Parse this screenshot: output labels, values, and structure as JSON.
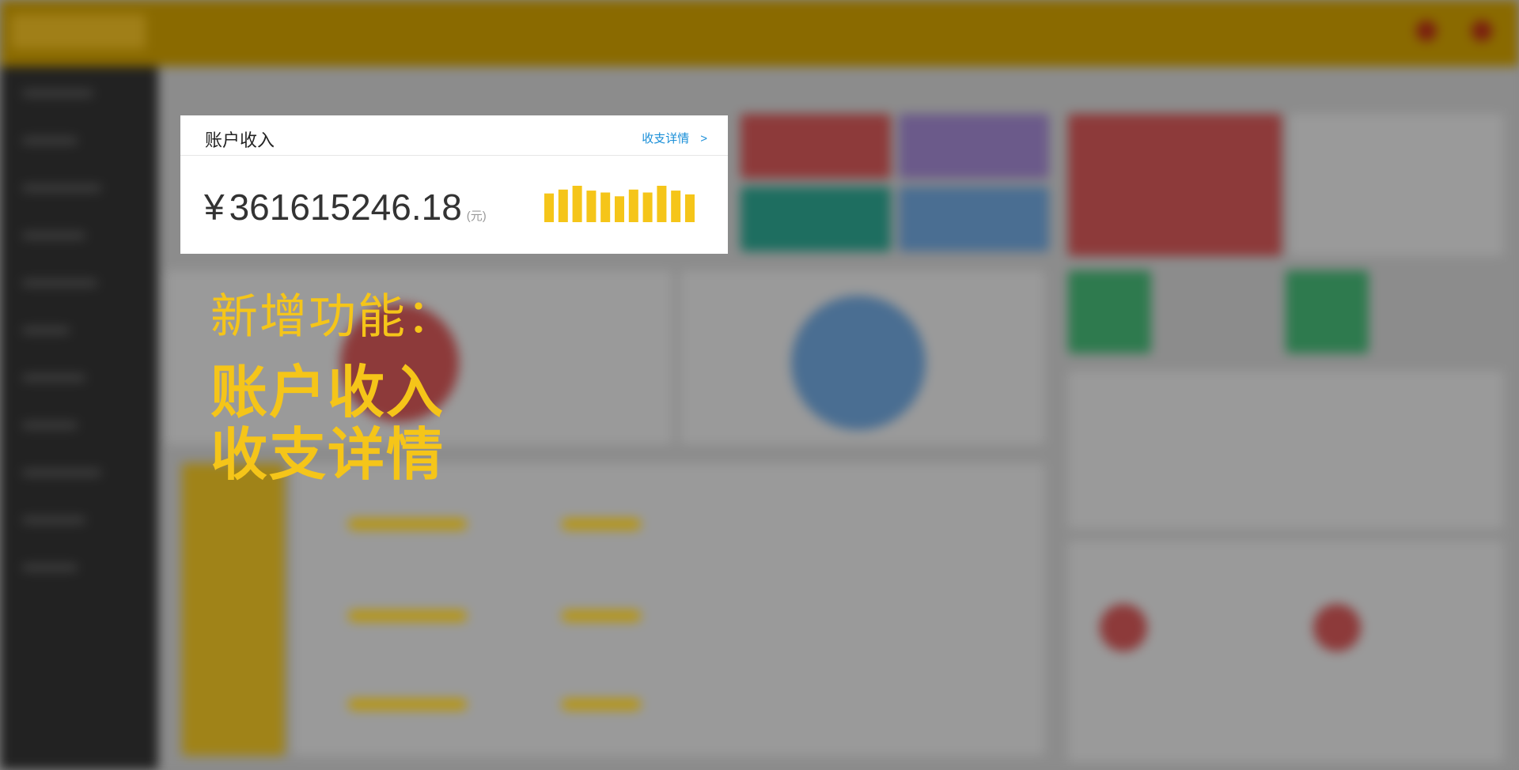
{
  "card": {
    "title": "账户收入",
    "detail_link": "收支详情",
    "detail_chevron": ">",
    "currency_symbol": "¥",
    "amount": "361615246.18",
    "unit": "(元)",
    "accent_color": "#f5c519"
  },
  "mini_chart": {
    "type": "bar",
    "values": [
      30,
      34,
      38,
      33,
      31,
      27,
      34,
      31,
      38,
      33,
      29
    ]
  },
  "feature": {
    "label": "新增功能：",
    "lines": [
      "账户收入",
      "收支详情"
    ]
  },
  "colors": {
    "header": "#8a6a00",
    "sidebar": "#222222",
    "link": "#1a8fd8",
    "highlight": "#f5c519"
  }
}
